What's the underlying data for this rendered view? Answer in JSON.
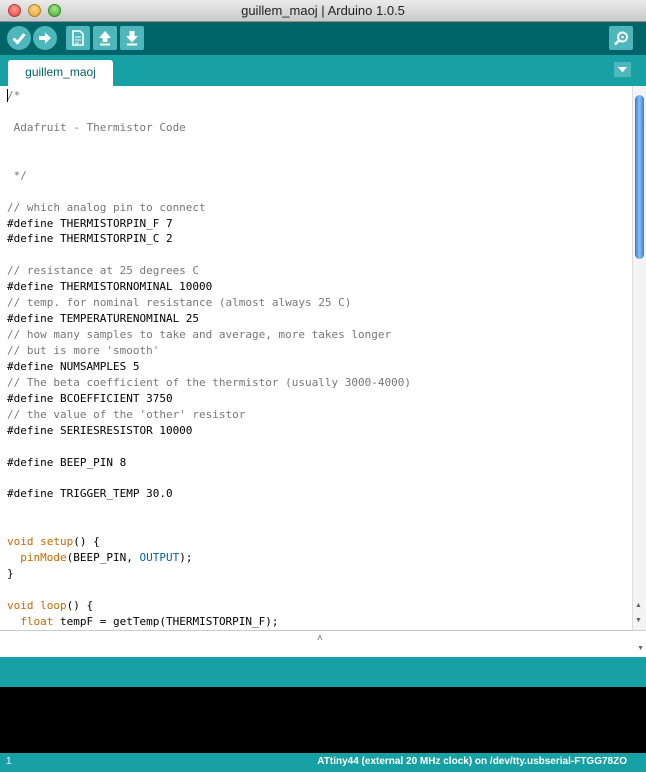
{
  "window": {
    "title": "guillem_maoj | Arduino 1.0.5"
  },
  "toolbar": {
    "buttons": [
      {
        "name": "verify",
        "icon": "checkmark-icon"
      },
      {
        "name": "upload",
        "icon": "arrow-right-icon"
      },
      {
        "name": "new",
        "icon": "new-file-icon"
      },
      {
        "name": "open",
        "icon": "arrow-up-icon"
      },
      {
        "name": "save",
        "icon": "arrow-down-icon"
      },
      {
        "name": "serial-monitor",
        "icon": "magnifier-icon"
      }
    ]
  },
  "tabs": [
    {
      "label": "guillem_maoj",
      "active": true
    }
  ],
  "editor": {
    "lines": [
      [
        {
          "t": "/*",
          "c": "comment"
        }
      ],
      [
        {
          "t": "",
          "c": ""
        }
      ],
      [
        {
          "t": " Adafruit - Thermistor Code",
          "c": "comment"
        }
      ],
      [
        {
          "t": "",
          "c": ""
        }
      ],
      [
        {
          "t": "",
          "c": ""
        }
      ],
      [
        {
          "t": " */",
          "c": "comment"
        }
      ],
      [
        {
          "t": "",
          "c": ""
        }
      ],
      [
        {
          "t": "// which analog pin to connect",
          "c": "comment"
        }
      ],
      [
        {
          "t": "#define THERMISTORPIN_F 7",
          "c": ""
        }
      ],
      [
        {
          "t": "#define THERMISTORPIN_C 2",
          "c": ""
        }
      ],
      [
        {
          "t": "",
          "c": ""
        }
      ],
      [
        {
          "t": "// resistance at 25 degrees C",
          "c": "comment"
        }
      ],
      [
        {
          "t": "#define THERMISTORNOMINAL 10000",
          "c": ""
        }
      ],
      [
        {
          "t": "// temp. for nominal resistance (almost always 25 C)",
          "c": "comment"
        }
      ],
      [
        {
          "t": "#define TEMPERATURENOMINAL 25",
          "c": ""
        }
      ],
      [
        {
          "t": "// how many samples to take and average, more takes longer",
          "c": "comment"
        }
      ],
      [
        {
          "t": "// but is more 'smooth'",
          "c": "comment"
        }
      ],
      [
        {
          "t": "#define NUMSAMPLES 5",
          "c": ""
        }
      ],
      [
        {
          "t": "// The beta coefficient of the thermistor (usually 3000-4000)",
          "c": "comment"
        }
      ],
      [
        {
          "t": "#define BCOEFFICIENT 3750",
          "c": ""
        }
      ],
      [
        {
          "t": "// the value of the 'other' resistor",
          "c": "comment"
        }
      ],
      [
        {
          "t": "#define SERIESRESISTOR 10000",
          "c": ""
        }
      ],
      [
        {
          "t": "",
          "c": ""
        }
      ],
      [
        {
          "t": "#define BEEP_PIN 8",
          "c": ""
        }
      ],
      [
        {
          "t": "",
          "c": ""
        }
      ],
      [
        {
          "t": "#define TRIGGER_TEMP 30.0",
          "c": ""
        }
      ],
      [
        {
          "t": "",
          "c": ""
        }
      ],
      [
        {
          "t": "",
          "c": ""
        }
      ],
      [
        {
          "t": "void",
          "c": "kw"
        },
        {
          "t": " ",
          "c": ""
        },
        {
          "t": "setup",
          "c": "kw"
        },
        {
          "t": "() {",
          "c": ""
        }
      ],
      [
        {
          "t": "  ",
          "c": ""
        },
        {
          "t": "pinMode",
          "c": "kw"
        },
        {
          "t": "(BEEP_PIN, ",
          "c": ""
        },
        {
          "t": "OUTPUT",
          "c": "const"
        },
        {
          "t": ");",
          "c": ""
        }
      ],
      [
        {
          "t": "}",
          "c": ""
        }
      ],
      [
        {
          "t": "",
          "c": ""
        }
      ],
      [
        {
          "t": "void",
          "c": "kw"
        },
        {
          "t": " ",
          "c": ""
        },
        {
          "t": "loop",
          "c": "kw"
        },
        {
          "t": "() {",
          "c": ""
        }
      ],
      [
        {
          "t": "  ",
          "c": ""
        },
        {
          "t": "float",
          "c": "kw"
        },
        {
          "t": " tempF = getTemp(THERMISTORPIN_F);",
          "c": ""
        }
      ]
    ]
  },
  "status": {
    "line": "1",
    "board": "ATtiny44 (external 20 MHz clock) on /dev/tty.usbserial-FTGG78ZO"
  },
  "colors": {
    "toolbar": "#006468",
    "tabbar": "#17a1a5",
    "button": "#4db7bb",
    "comment": "#777777",
    "keyword": "#cc6600",
    "constant": "#006699"
  }
}
